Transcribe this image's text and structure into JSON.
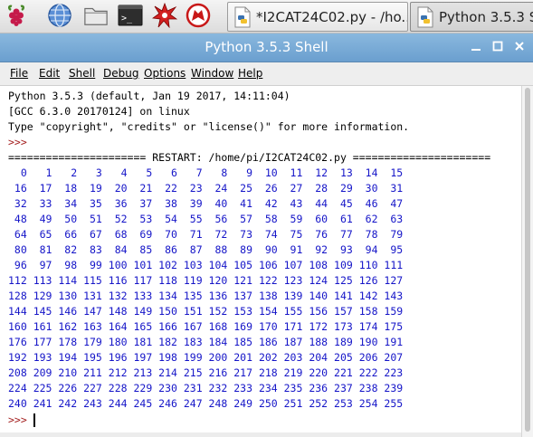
{
  "taskbar": {
    "icons": [
      "raspberry-menu-icon",
      "web-browser-icon",
      "file-manager-icon",
      "terminal-icon",
      "math-splat-icon",
      "wolfram-icon"
    ],
    "tasks": [
      {
        "label": "*I2CAT24C02.py - /ho...",
        "icon": "python-file-icon",
        "active": false
      },
      {
        "label": "Python 3.5.3 S",
        "icon": "python-file-icon",
        "active": true
      }
    ]
  },
  "window": {
    "title": "Python 3.5.3 Shell",
    "controls": [
      "minimize-icon",
      "maximize-icon",
      "close-icon"
    ]
  },
  "menubar": {
    "items": [
      "File",
      "Edit",
      "Shell",
      "Debug",
      "Options",
      "Window",
      "Help"
    ]
  },
  "shell": {
    "header": [
      "Python 3.5.3 (default, Jan 19 2017, 14:11:04)",
      "[GCC 6.3.0 20170124] on linux",
      "Type \"copyright\", \"credits\" or \"license()\" for more information."
    ],
    "prompt": ">>>",
    "restart": "====================== RESTART: /home/pi/I2CAT24C02.py ======================",
    "number_rows": [
      "  0   1   2   3   4   5   6   7   8   9  10  11  12  13  14  15",
      " 16  17  18  19  20  21  22  23  24  25  26  27  28  29  30  31",
      " 32  33  34  35  36  37  38  39  40  41  42  43  44  45  46  47",
      " 48  49  50  51  52  53  54  55  56  57  58  59  60  61  62  63",
      " 64  65  66  67  68  69  70  71  72  73  74  75  76  77  78  79",
      " 80  81  82  83  84  85  86  87  88  89  90  91  92  93  94  95",
      " 96  97  98  99 100 101 102 103 104 105 106 107 108 109 110 111",
      "112 113 114 115 116 117 118 119 120 121 122 123 124 125 126 127",
      "128 129 130 131 132 133 134 135 136 137 138 139 140 141 142 143",
      "144 145 146 147 148 149 150 151 152 153 154 155 156 157 158 159",
      "160 161 162 163 164 165 166 167 168 169 170 171 172 173 174 175",
      "176 177 178 179 180 181 182 183 184 185 186 187 188 189 190 191",
      "192 193 194 195 196 197 198 199 200 201 202 203 204 205 206 207",
      "208 209 210 211 212 213 214 215 216 217 218 219 220 221 222 223",
      "224 225 226 227 228 229 230 231 232 233 234 235 236 237 238 239",
      "240 241 242 243 244 245 246 247 248 249 250 251 252 253 254 255"
    ],
    "final_prompt": ">>>"
  },
  "colors": {
    "output_text": "#000000",
    "prompt": "#a42020",
    "program_output": "#1515c8",
    "titlebar": "#7aaad6"
  }
}
